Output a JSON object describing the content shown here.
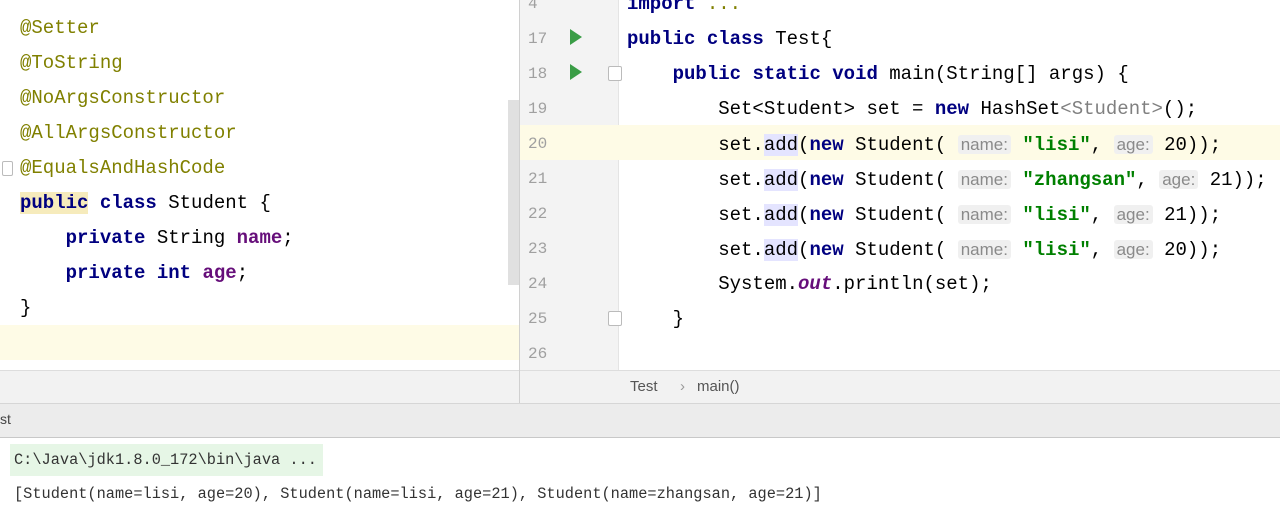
{
  "colors": {
    "keyword": "#000080",
    "annotation": "#808000",
    "string": "#008000",
    "field": "#660e7a",
    "current_line": "#fefbe6",
    "run_icon": "#3a9d46"
  },
  "left_editor": {
    "lines": [
      [
        [
          "@Setter",
          "ann"
        ]
      ],
      [
        [
          "@ToString",
          "ann"
        ]
      ],
      [
        [
          "@NoArgsConstructor",
          "ann"
        ]
      ],
      [
        [
          "@AllArgsConstructor",
          "ann"
        ]
      ],
      [
        [
          "@EqualsAndHashCode",
          "ann"
        ]
      ],
      [
        [
          "public",
          "kw fold-kw"
        ],
        [
          " ",
          ""
        ],
        [
          "class",
          "kw"
        ],
        [
          " Student {",
          ""
        ]
      ],
      [
        [
          "    ",
          ""
        ],
        [
          "private",
          "kw"
        ],
        [
          " String ",
          ""
        ],
        [
          "name",
          "fld"
        ],
        [
          ";",
          ""
        ]
      ],
      [
        [
          "    ",
          ""
        ],
        [
          "private",
          "kw"
        ],
        [
          " ",
          ""
        ],
        [
          "int",
          "kw"
        ],
        [
          " ",
          ""
        ],
        [
          "age",
          "fld"
        ],
        [
          ";",
          ""
        ]
      ],
      [
        [
          "}",
          ""
        ]
      ]
    ]
  },
  "right_editor": {
    "line_numbers": [
      "4",
      "17",
      "18",
      "19",
      "20",
      "21",
      "22",
      "23",
      "24",
      "25",
      "26"
    ],
    "lines": [
      [
        [
          "import",
          "kw"
        ],
        [
          " ...",
          "ann"
        ]
      ],
      [
        [
          "public",
          "kw"
        ],
        [
          " ",
          ""
        ],
        [
          "class",
          "kw"
        ],
        [
          " Test{",
          ""
        ]
      ],
      [
        [
          "    ",
          ""
        ],
        [
          "public",
          "kw"
        ],
        [
          " ",
          ""
        ],
        [
          "static",
          "kw"
        ],
        [
          " ",
          ""
        ],
        [
          "void",
          "kw"
        ],
        [
          " main(String[] args) {",
          ""
        ]
      ],
      [
        [
          "        Set<Student> set = ",
          ""
        ],
        [
          "new",
          "kw"
        ],
        [
          " HashSet",
          ""
        ],
        [
          "<Student>",
          "gray"
        ],
        [
          "();",
          ""
        ]
      ],
      [
        [
          "        set.",
          ""
        ],
        [
          "add",
          "meth"
        ],
        [
          "(",
          ""
        ],
        [
          "new",
          "kw"
        ],
        [
          " Student( ",
          ""
        ],
        [
          "name:",
          "hint"
        ],
        [
          " ",
          ""
        ],
        [
          "\"lisi\"",
          "str"
        ],
        [
          ", ",
          ""
        ],
        [
          "age:",
          "hint"
        ],
        [
          " 20));",
          ""
        ]
      ],
      [
        [
          "        set.",
          ""
        ],
        [
          "add",
          "meth"
        ],
        [
          "(",
          ""
        ],
        [
          "new",
          "kw"
        ],
        [
          " Student( ",
          ""
        ],
        [
          "name:",
          "hint"
        ],
        [
          " ",
          ""
        ],
        [
          "\"zhangsan\"",
          "str"
        ],
        [
          ", ",
          ""
        ],
        [
          "age:",
          "hint"
        ],
        [
          " 21));",
          ""
        ]
      ],
      [
        [
          "        set.",
          ""
        ],
        [
          "add",
          "meth"
        ],
        [
          "(",
          ""
        ],
        [
          "new",
          "kw"
        ],
        [
          " Student( ",
          ""
        ],
        [
          "name:",
          "hint"
        ],
        [
          " ",
          ""
        ],
        [
          "\"lisi\"",
          "str"
        ],
        [
          ", ",
          ""
        ],
        [
          "age:",
          "hint"
        ],
        [
          " 21));",
          ""
        ]
      ],
      [
        [
          "        set.",
          ""
        ],
        [
          "add",
          "meth"
        ],
        [
          "(",
          ""
        ],
        [
          "new",
          "kw"
        ],
        [
          " Student( ",
          ""
        ],
        [
          "name:",
          "hint"
        ],
        [
          " ",
          ""
        ],
        [
          "\"lisi\"",
          "str"
        ],
        [
          ", ",
          ""
        ],
        [
          "age:",
          "hint"
        ],
        [
          " 20));",
          ""
        ]
      ],
      [
        [
          "        System.",
          ""
        ],
        [
          "out",
          "static"
        ],
        [
          ".println(set);",
          ""
        ]
      ],
      [
        [
          "    }",
          ""
        ]
      ],
      []
    ]
  },
  "breadcrumb": {
    "items": [
      "Test",
      "main()"
    ],
    "separator": "›"
  },
  "run_panel": {
    "tab_label": "st"
  },
  "console": {
    "lines": [
      "C:\\Java\\jdk1.8.0_172\\bin\\java ...",
      "[Student(name=lisi, age=20), Student(name=lisi, age=21), Student(name=zhangsan, age=21)]"
    ]
  }
}
